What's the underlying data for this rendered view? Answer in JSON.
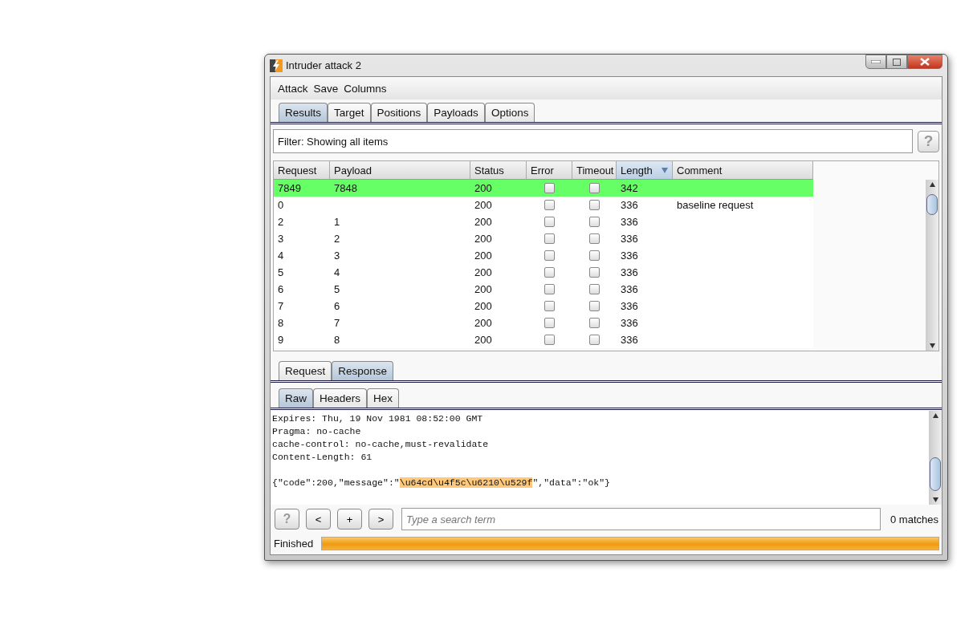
{
  "window": {
    "title": "Intruder attack 2"
  },
  "menu": [
    "Attack",
    "Save",
    "Columns"
  ],
  "tabs": [
    {
      "label": "Results",
      "selected": true
    },
    {
      "label": "Target",
      "selected": false
    },
    {
      "label": "Positions",
      "selected": false
    },
    {
      "label": "Payloads",
      "selected": false
    },
    {
      "label": "Options",
      "selected": false
    }
  ],
  "filter": {
    "text": "Filter: Showing all items",
    "help": "?"
  },
  "table": {
    "columns": [
      {
        "label": "Request",
        "sorted": false
      },
      {
        "label": "Payload",
        "sorted": false
      },
      {
        "label": "Status",
        "sorted": false
      },
      {
        "label": "Error",
        "sorted": false
      },
      {
        "label": "Timeout",
        "sorted": false
      },
      {
        "label": "Length",
        "sorted": true
      },
      {
        "label": "Comment",
        "sorted": false
      }
    ],
    "rows": [
      {
        "request": "7849",
        "payload": "7848",
        "status": "200",
        "error": false,
        "timeout": false,
        "length": "342",
        "comment": "",
        "highlighted": true
      },
      {
        "request": "0",
        "payload": "",
        "status": "200",
        "error": false,
        "timeout": false,
        "length": "336",
        "comment": "baseline request",
        "highlighted": false
      },
      {
        "request": "2",
        "payload": "1",
        "status": "200",
        "error": false,
        "timeout": false,
        "length": "336",
        "comment": "",
        "highlighted": false
      },
      {
        "request": "3",
        "payload": "2",
        "status": "200",
        "error": false,
        "timeout": false,
        "length": "336",
        "comment": "",
        "highlighted": false
      },
      {
        "request": "4",
        "payload": "3",
        "status": "200",
        "error": false,
        "timeout": false,
        "length": "336",
        "comment": "",
        "highlighted": false
      },
      {
        "request": "5",
        "payload": "4",
        "status": "200",
        "error": false,
        "timeout": false,
        "length": "336",
        "comment": "",
        "highlighted": false
      },
      {
        "request": "6",
        "payload": "5",
        "status": "200",
        "error": false,
        "timeout": false,
        "length": "336",
        "comment": "",
        "highlighted": false
      },
      {
        "request": "7",
        "payload": "6",
        "status": "200",
        "error": false,
        "timeout": false,
        "length": "336",
        "comment": "",
        "highlighted": false
      },
      {
        "request": "8",
        "payload": "7",
        "status": "200",
        "error": false,
        "timeout": false,
        "length": "336",
        "comment": "",
        "highlighted": false
      },
      {
        "request": "9",
        "payload": "8",
        "status": "200",
        "error": false,
        "timeout": false,
        "length": "336",
        "comment": "",
        "highlighted": false
      }
    ]
  },
  "message_tabs": [
    {
      "label": "Request",
      "selected": false
    },
    {
      "label": "Response",
      "selected": true
    }
  ],
  "view_tabs": [
    {
      "label": "Raw",
      "selected": true
    },
    {
      "label": "Headers",
      "selected": false
    },
    {
      "label": "Hex",
      "selected": false
    }
  ],
  "response": {
    "headers": [
      "Expires: Thu, 19 Nov 1981 08:52:00 GMT",
      "Pragma: no-cache",
      "cache-control: no-cache,must-revalidate",
      "Content-Length: 61"
    ],
    "body": [
      {
        "text": "{\"code\":200,\"message\":\"",
        "highlighted": false
      },
      {
        "text": "\\u64cd\\u4f5c\\u6210\\u529f",
        "highlighted": true
      },
      {
        "text": "\",\"data\":\"ok\"}",
        "highlighted": false
      }
    ]
  },
  "search": {
    "buttons": [
      "?",
      "<",
      "+",
      ">"
    ],
    "placeholder": "Type a search term",
    "matches": "0 matches"
  },
  "status_bar": {
    "text": "Finished",
    "level": 1
  }
}
